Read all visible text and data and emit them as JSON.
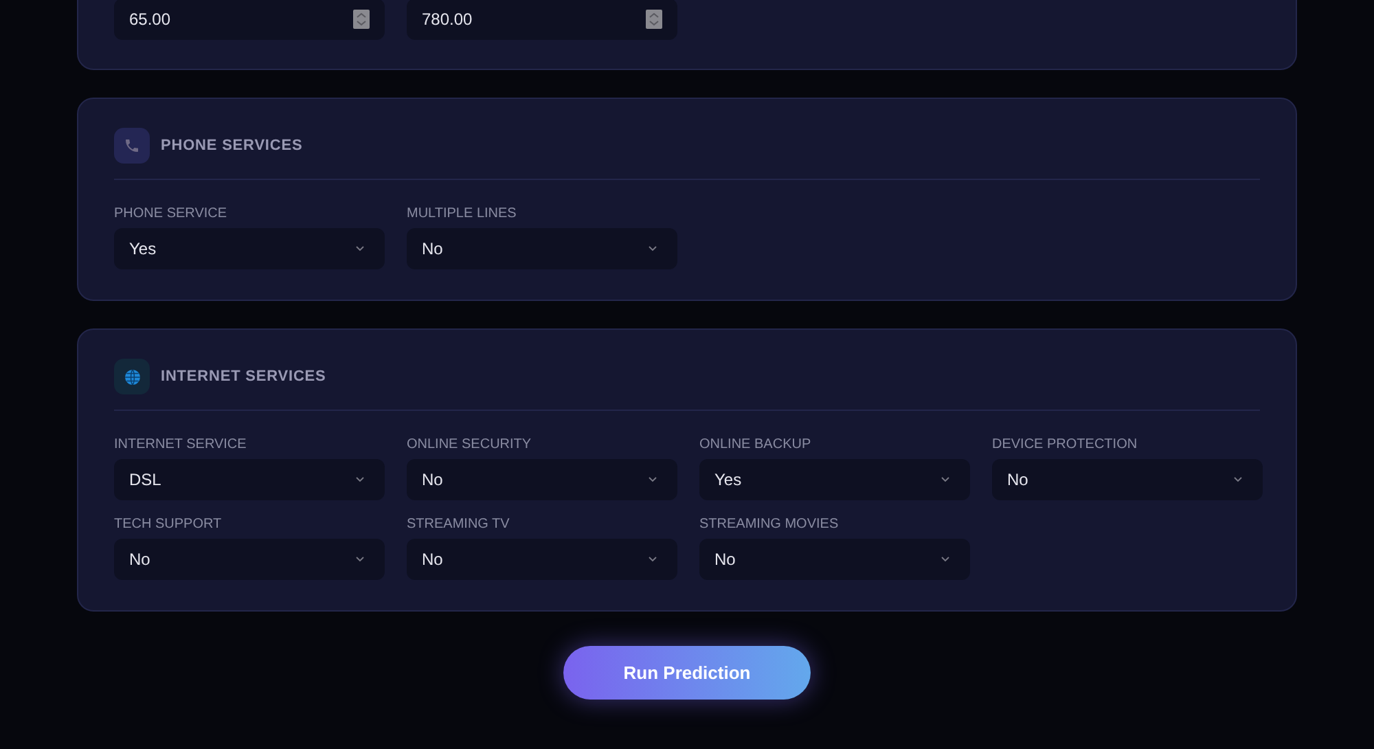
{
  "charges_section": {
    "fields": [
      {
        "value": "65.00"
      },
      {
        "value": "780.00"
      }
    ]
  },
  "sections": [
    {
      "kind": "phone",
      "title": "PHONE SERVICES",
      "fields": [
        {
          "label": "PHONE SERVICE",
          "value": "Yes"
        },
        {
          "label": "MULTIPLE LINES",
          "value": "No"
        }
      ]
    },
    {
      "kind": "internet",
      "title": "INTERNET SERVICES",
      "fields": [
        {
          "label": "INTERNET SERVICE",
          "value": "DSL"
        },
        {
          "label": "ONLINE SECURITY",
          "value": "No"
        },
        {
          "label": "ONLINE BACKUP",
          "value": "Yes"
        },
        {
          "label": "DEVICE PROTECTION",
          "value": "No"
        },
        {
          "label": "TECH SUPPORT",
          "value": "No"
        },
        {
          "label": "STREAMING TV",
          "value": "No"
        },
        {
          "label": "STREAMING MOVIES",
          "value": "No"
        }
      ]
    }
  ],
  "submit_button": "Run Prediction"
}
